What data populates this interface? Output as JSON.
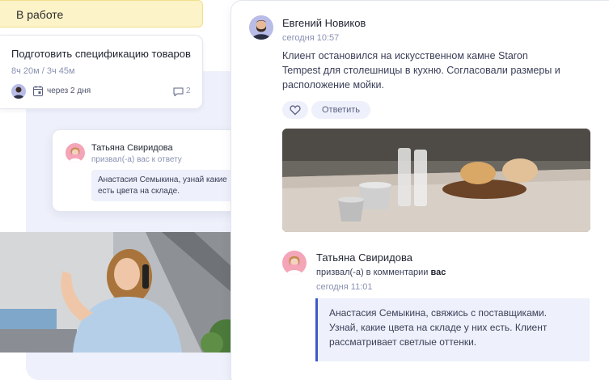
{
  "status": {
    "label": "В работе"
  },
  "task": {
    "title": "Подготовить спецификацию товаров",
    "time_spent": "8ч 20м / 3ч 45м",
    "due": "через 2 дня",
    "comment_count": "2"
  },
  "notification": {
    "author": "Татьяна Свиридова",
    "action": "призвал(-а) вас к ответу",
    "quote": "Анастасия Семыкина, узнай какие есть цвета на складе."
  },
  "comments": [
    {
      "author": "Евгений Новиков",
      "time": "сегодня 10:57",
      "text": "Клиент остановился на искусственном камне Staron Tempest для столешницы в кухню. Согласовали размеры и расположение мойки.",
      "reply_label": "Ответить"
    },
    {
      "author": "Татьяна Свиридова",
      "action_prefix": "призвал(-а) в комментарии",
      "action_target": "вас",
      "time": "сегодня 11:01",
      "quote": "Анастасия Семыкина, свяжись с поставщиками. Узнай, какие цвета на складе у них есть. Клиент рассматривает светлые оттенки."
    }
  ],
  "colors": {
    "accent": "#3d5bc9",
    "status_bg": "#fdf3c8",
    "muted_text": "#8a92b2",
    "quote_bg": "#eef0fb"
  },
  "icons": [
    "calendar-icon",
    "comment-icon",
    "heart-icon"
  ]
}
